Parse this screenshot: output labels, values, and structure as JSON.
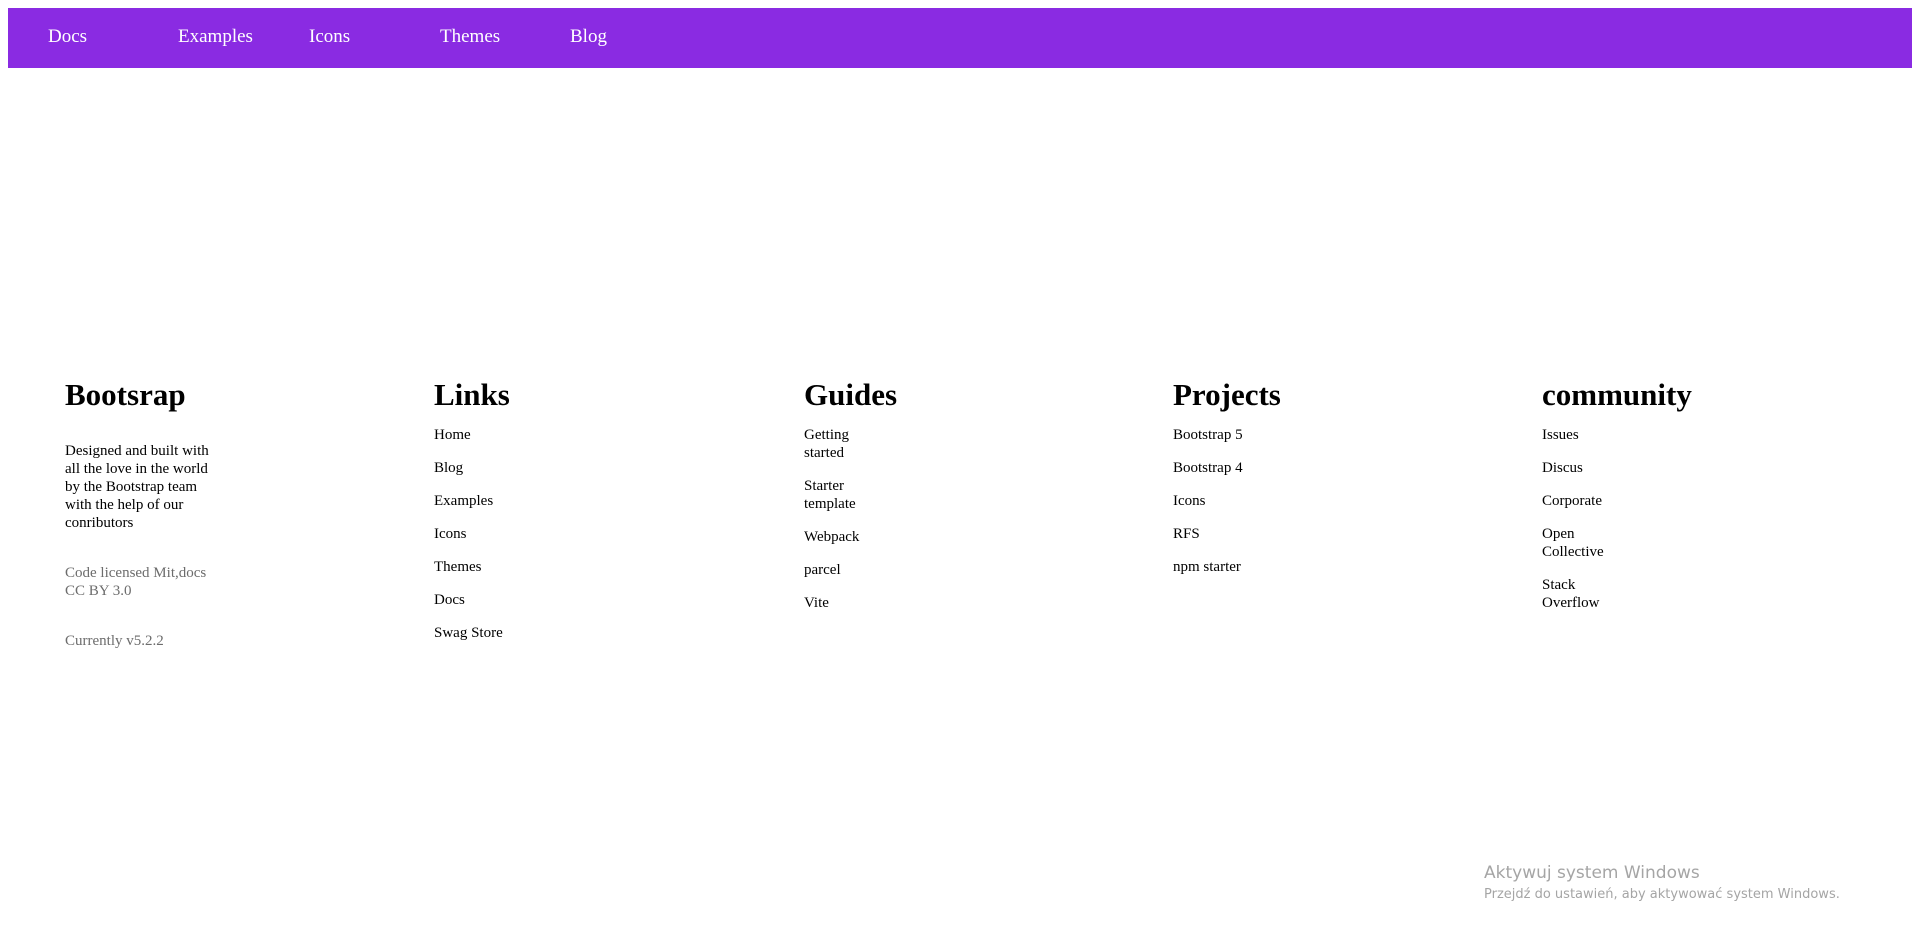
{
  "navbar": {
    "background": "#8a2be2",
    "links": [
      "Docs",
      "Examples",
      "Icons",
      "Themes",
      "Blog"
    ]
  },
  "footer": {
    "brand": {
      "title": "Bootsrap",
      "description": "Designed and built with all the love in the world by the Bootstrap team with the help of our conributors",
      "license": "Code licensed Mit,docs CC BY 3.0",
      "version": "Currently v5.2.2"
    },
    "links": {
      "title": "Links",
      "items": [
        "Home",
        "Blog",
        "Examples",
        "Icons",
        "Themes",
        "Docs",
        "Swag Store"
      ]
    },
    "guides": {
      "title": "Guides",
      "items": [
        "Getting started",
        "Starter template",
        "Webpack",
        "parcel",
        "Vite"
      ]
    },
    "projects": {
      "title": "Projects",
      "items": [
        "Bootstrap 5",
        "Bootstrap 4",
        "Icons",
        "RFS",
        "npm starter"
      ]
    },
    "community": {
      "title": "community",
      "items": [
        "Issues",
        "Discus",
        "Corporate",
        "Open Collective",
        "Stack Overflow"
      ]
    }
  },
  "watermark": {
    "title": "Aktywuj system Windows",
    "subtitle": "Przejdź do ustawień, aby aktywować system Windows."
  }
}
